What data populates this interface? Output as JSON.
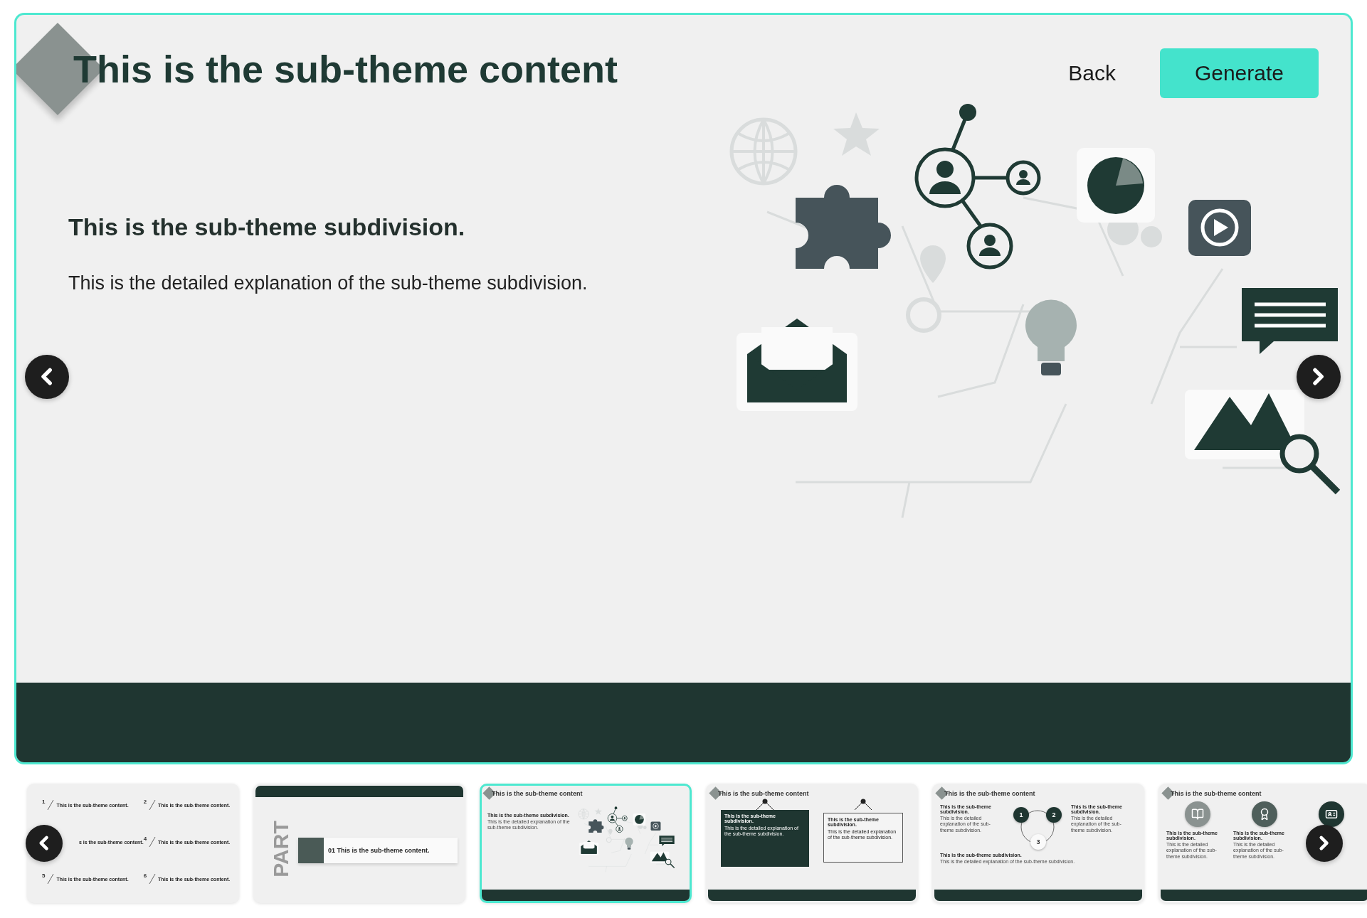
{
  "slide": {
    "title": "This is the sub-theme content",
    "subtitle": "This is the sub-theme subdivision.",
    "body": "This is the detailed explanation of the sub-theme subdivision."
  },
  "actions": [
    {
      "label": "Back",
      "kind": "text"
    },
    {
      "label": "Generate",
      "kind": "primary"
    }
  ],
  "thumbnails": [
    {
      "kind": "list",
      "selected": false,
      "items": [
        {
          "number": "1",
          "text": "This is the sub-theme content."
        },
        {
          "number": "2",
          "text": "This is the sub-theme content."
        },
        {
          "text": "s is the sub-theme content."
        },
        {
          "number": "4",
          "text": "This is the sub-theme content."
        },
        {
          "number": "5",
          "text": "This is the sub-theme content."
        },
        {
          "number": "6",
          "text": "This is the sub-theme content."
        }
      ]
    },
    {
      "kind": "part",
      "selected": false,
      "watermark": "PART",
      "text": "01 This is the sub-theme content."
    },
    {
      "kind": "image",
      "selected": true,
      "title": "This is the sub-theme content",
      "subtitle": "This is the sub-theme subdivision.",
      "body": "This is the detailed explanation of the sub-theme subdivision."
    },
    {
      "kind": "boards",
      "selected": false,
      "title": "This is the sub-theme content",
      "boards": [
        {
          "kind": "dark",
          "title": "This is the sub-theme subdivision.",
          "body": "This is the detailed explanation of the sub-theme subdivision."
        },
        {
          "kind": "light",
          "title": "This is the sub-theme subdivision.",
          "body": "This is the detailed explanation of the sub-theme subdivision."
        }
      ]
    },
    {
      "kind": "cycle",
      "selected": false,
      "title": "This is the sub-theme content",
      "steps": [
        "1",
        "2",
        "3"
      ],
      "blocks": [
        {
          "title": "This is the sub-theme subdivision.",
          "body": "This is the detailed explanation of the sub-theme subdivision."
        },
        {
          "title": "This is the sub-theme subdivision.",
          "body": "This is the detailed explanation of the sub-theme subdivision."
        },
        {
          "title": "This is the sub-theme subdivision.",
          "body": "This is the detailed explanation of the sub-theme subdivision."
        }
      ]
    },
    {
      "kind": "icons",
      "selected": false,
      "title": "This is the sub-theme content",
      "columns": [
        {
          "kind": "book",
          "title": "This is the sub-theme subdivision.",
          "body": "This is the detailed explanation of the sub-theme subdivision."
        },
        {
          "kind": "award",
          "title": "This is the sub-theme subdivision.",
          "body": "This is the detailed explanation of the sub-theme subdivision."
        },
        {
          "kind": "badge"
        }
      ]
    }
  ]
}
